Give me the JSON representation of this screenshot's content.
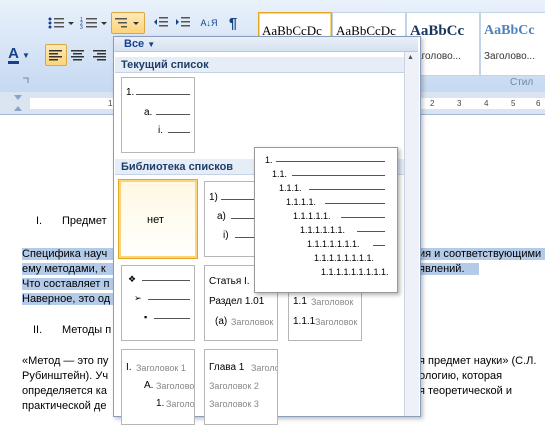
{
  "ribbon": {
    "font_color_letter": "A",
    "sort_label": "А↓Я",
    "pilcrow": "¶",
    "styles": [
      {
        "sample": "AaBbCcDc",
        "name": ""
      },
      {
        "sample": "AaBbCcDc",
        "name": ""
      },
      {
        "sample": "AaBbCc",
        "name": "Заголово..."
      },
      {
        "sample": "AaBbCc",
        "name": "Заголово..."
      }
    ],
    "styles_group_label": "Стил"
  },
  "ruler": {
    "ticks": [
      "1",
      "2",
      "3",
      "4",
      "5",
      "6"
    ]
  },
  "document": {
    "heading1_num": "I.",
    "heading1_text": "Предмет",
    "para1_line1_left": "Специфика науч",
    "para1_line1_right": "ия и соответствующими",
    "para1_line2_left": "ему методами, к",
    "para1_line2_right": "явлений.",
    "para1_line3": "Что составляет п",
    "para1_line4": "Наверное, это од",
    "heading2_num": "II.",
    "heading2_text": "Методы п",
    "para2_line1_left": "«Метод — это пу",
    "para2_line1_right": "я предмет науки» (С.Л.",
    "para2_line2": "Рубинштейн). Уч",
    "para2_line2_right": "ологию, которая",
    "para2_line3": "определяется ка",
    "para2_line3_right": "я теоретической и",
    "para2_line4": "практической де"
  },
  "dropdown": {
    "filter_label": "Все",
    "section_current": "Текущий список",
    "current_tile": {
      "l1": "1.",
      "l2": "a.",
      "l3": "i."
    },
    "section_library": "Библиотека списков",
    "none_tile": "нет",
    "numbered_tile": {
      "l1": "1)",
      "l2": "a)",
      "l3": "i)"
    },
    "bullet_tile": {
      "b1": "❖",
      "b2": "➢",
      "b3": "▪"
    },
    "article_tile": {
      "l1": "Статья I.",
      "l2": "Раздел 1.01",
      "l3": "(a)",
      "l3_gray": "Заголовок"
    },
    "numeric_tile": {
      "l1": "1",
      "l2": "1.1",
      "l3": "1.1.1",
      "gray": "Заголовок"
    },
    "heading_tile": {
      "l1": "I.",
      "l2": "A.",
      "l3": "1.",
      "gray1": "Заголовок 1",
      "gray2": "Заголовок 2",
      "gray3": "Заголовок 3"
    },
    "chapter_tile": {
      "l1": "Глава 1",
      "gray1": "Заголово",
      "gray2": "Заголовок 2",
      "gray3": "Заголовок 3"
    }
  },
  "preview_popup": {
    "levels": [
      "1.",
      "1.1.",
      "1.1.1.",
      "1.1.1.1.",
      "1.1.1.1.1.",
      "1.1.1.1.1.1.",
      "1.1.1.1.1.1.1.",
      "1.1.1.1.1.1.1.1.",
      "1.1.1.1.1.1.1.1.1."
    ]
  }
}
